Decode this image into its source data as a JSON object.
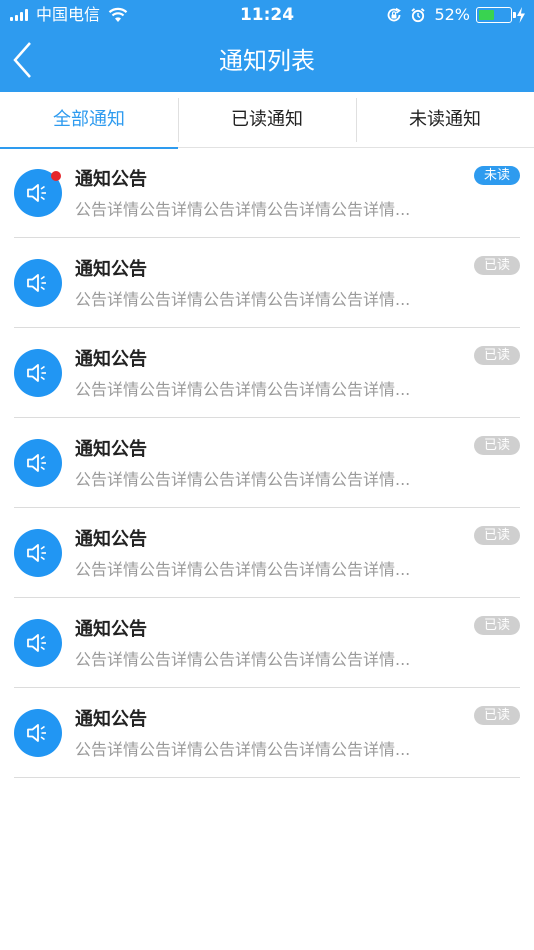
{
  "status_bar": {
    "carrier": "中国电信",
    "time": "11:24",
    "battery_percent": "52%",
    "battery_level": 0.52,
    "icons": [
      "signal-icon",
      "wifi-icon",
      "rotation-lock-icon",
      "alarm-icon",
      "battery-icon",
      "charging-icon"
    ]
  },
  "nav": {
    "title": "通知列表",
    "back_icon": "chevron-left-icon"
  },
  "tabs": [
    {
      "label": "全部通知",
      "active": true
    },
    {
      "label": "已读通知",
      "active": false
    },
    {
      "label": "未读通知",
      "active": false
    }
  ],
  "notifications": [
    {
      "title": "通知公告",
      "desc": "公告详情公告详情公告详情公告详情公告详情...",
      "status": "未读",
      "unread": true
    },
    {
      "title": "通知公告",
      "desc": "公告详情公告详情公告详情公告详情公告详情...",
      "status": "已读",
      "unread": false
    },
    {
      "title": "通知公告",
      "desc": "公告详情公告详情公告详情公告详情公告详情...",
      "status": "已读",
      "unread": false
    },
    {
      "title": "通知公告",
      "desc": "公告详情公告详情公告详情公告详情公告详情...",
      "status": "已读",
      "unread": false
    },
    {
      "title": "通知公告",
      "desc": "公告详情公告详情公告详情公告详情公告详情...",
      "status": "已读",
      "unread": false
    },
    {
      "title": "通知公告",
      "desc": "公告详情公告详情公告详情公告详情公告详情...",
      "status": "已读",
      "unread": false
    },
    {
      "title": "通知公告",
      "desc": "公告详情公告详情公告详情公告详情公告详情...",
      "status": "已读",
      "unread": false
    }
  ],
  "colors": {
    "primary": "#2e9bef",
    "avatar": "#2196f3",
    "unread_badge": "#2e9bef",
    "read_badge": "#cfcfcf",
    "unread_dot": "#e5262b",
    "battery_fill": "#39d350"
  }
}
